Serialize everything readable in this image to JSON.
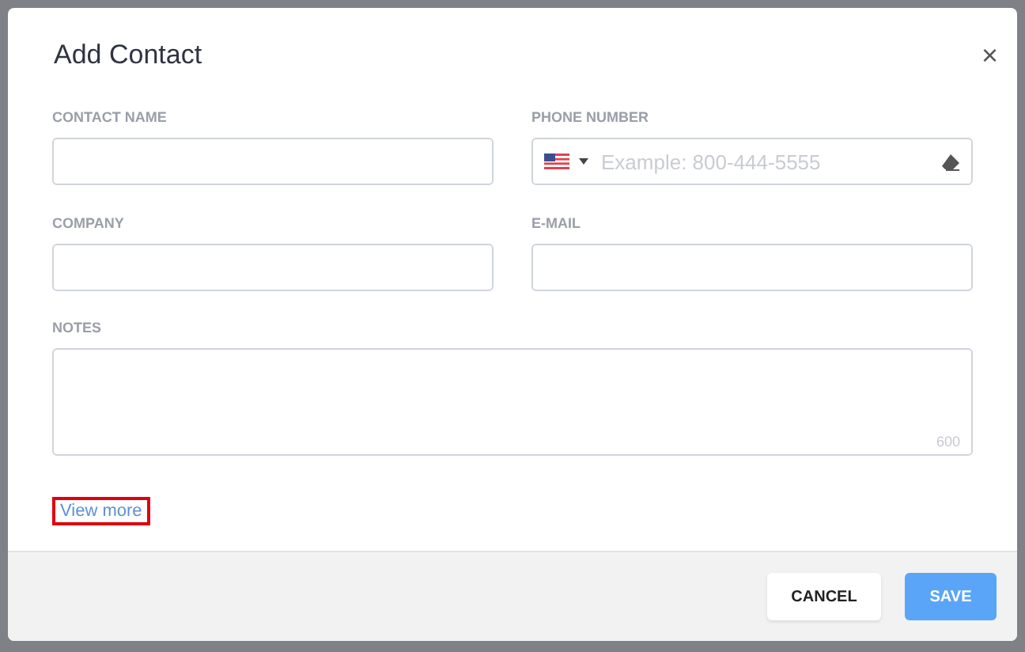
{
  "dialog": {
    "title": "Add Contact",
    "close": "×"
  },
  "fields": [
    {
      "label": "CONTACT NAME",
      "kind": "text"
    },
    {
      "label": "PHONE NUMBER",
      "kind": "phone",
      "placeholder": "Example: 800-444-5555"
    },
    {
      "label": "COMPANY",
      "kind": "text"
    },
    {
      "label": "E-MAIL",
      "kind": "text"
    }
  ],
  "notes": {
    "label": "NOTES",
    "counter": "600"
  },
  "view_more": {
    "label": "View more",
    "highlighted": true
  },
  "buttons": [
    {
      "label": "CANCEL",
      "kind": "secondary"
    },
    {
      "label": "SAVE",
      "kind": "primary"
    }
  ]
}
